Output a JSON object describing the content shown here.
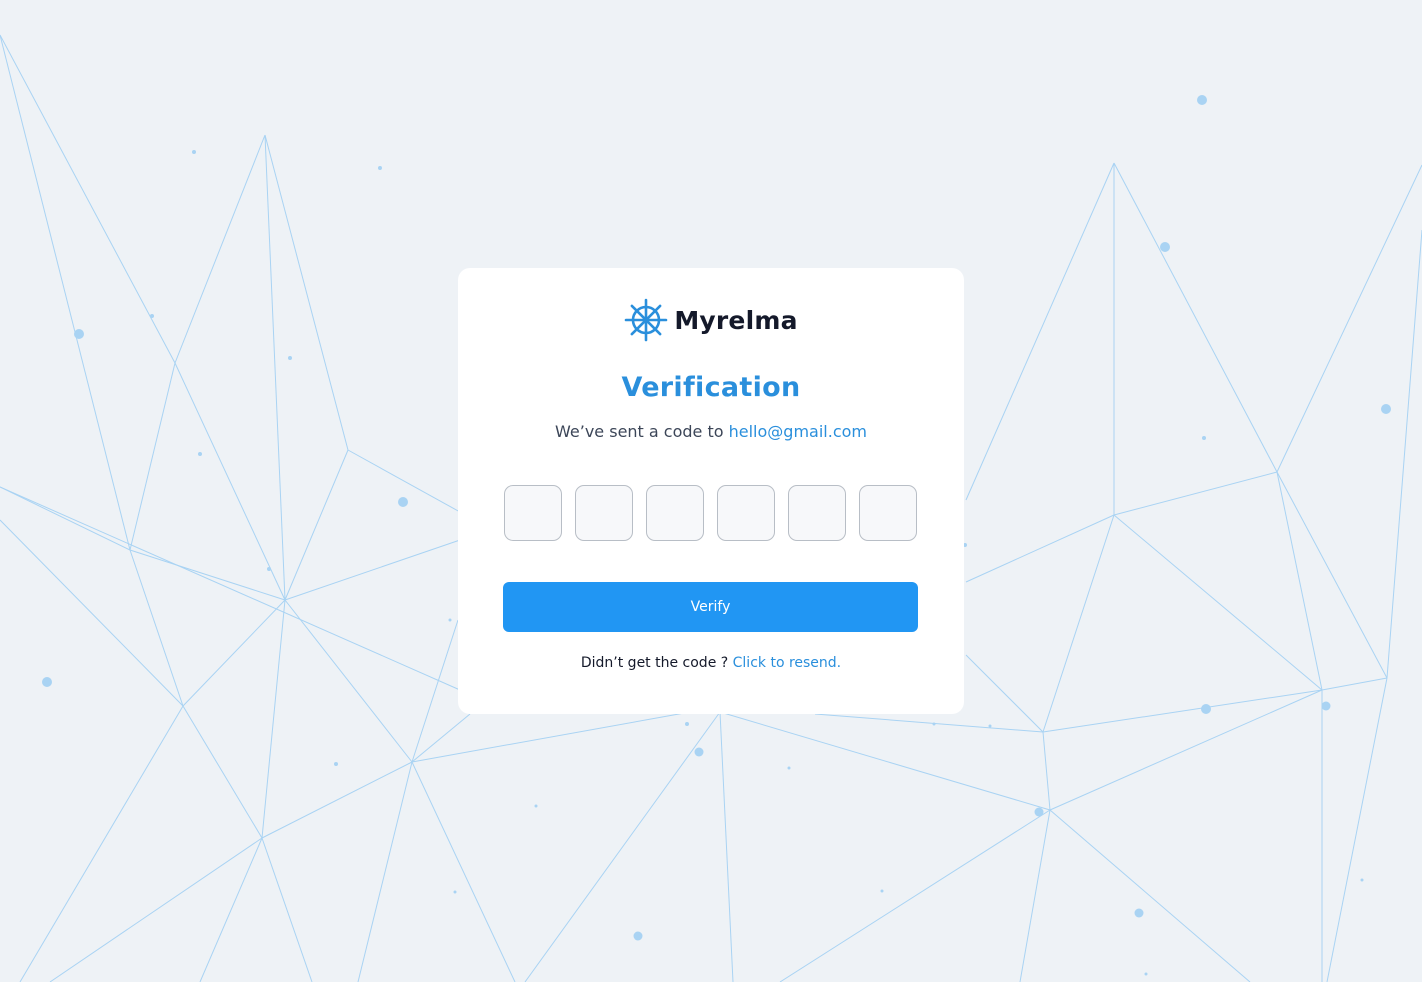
{
  "brand": {
    "name": "Myrelma",
    "icon": "ship-wheel-icon",
    "color": "#2a8fdc"
  },
  "verification": {
    "title": "Verification",
    "subtitle_prefix": "We’ve sent a code to",
    "email": "hello@gmail.com",
    "code_digits": [
      "",
      "",
      "",
      "",
      "",
      ""
    ],
    "verify_label": "Verify",
    "resend_prompt": "Didn’t get the code ?",
    "resend_link": "Click to resend."
  },
  "colors": {
    "accent": "#2196f3",
    "title": "#2a8fdc",
    "background": "#eef2f6",
    "network_lines": "#a9d3f3"
  }
}
